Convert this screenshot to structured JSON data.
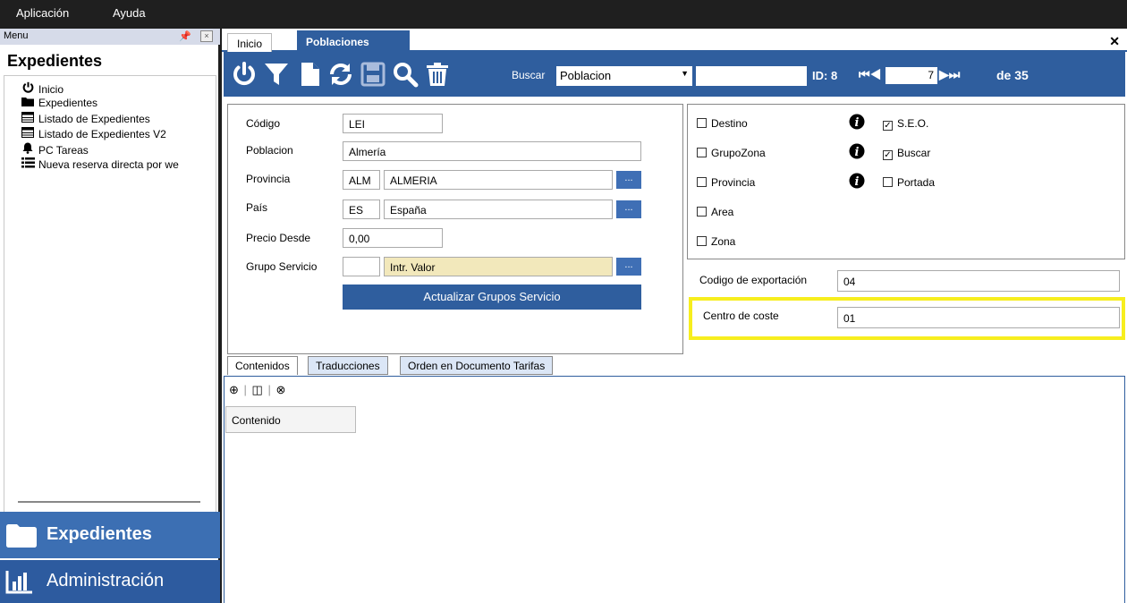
{
  "menubar": {
    "items": [
      "Aplicación",
      "Ayuda"
    ]
  },
  "leftpanel": {
    "header": "Menu",
    "title": "Expedientes",
    "tree": [
      {
        "label": "Inicio",
        "icon": "power-icon"
      },
      {
        "label": "Expedientes",
        "icon": "folder-icon"
      },
      {
        "label": "Listado de Expedientes",
        "icon": "table-icon"
      },
      {
        "label": "Listado de Expedientes V2",
        "icon": "table-icon"
      },
      {
        "label": "PC Tareas",
        "icon": "bell-icon"
      },
      {
        "label": "Nueva reserva directa por we",
        "icon": "list-icon"
      }
    ],
    "nav": {
      "expedientes": "Expedientes",
      "administracion": "Administración"
    }
  },
  "tabs": {
    "inicio": "Inicio",
    "poblaciones": "Poblaciones"
  },
  "toolbar": {
    "buscar_label": "Buscar",
    "buscar_select": "Poblacion",
    "id_label": "ID: 8",
    "page": "7",
    "total": "de 35"
  },
  "form": {
    "codigo_label": "Código",
    "codigo": "LEI",
    "poblacion_label": "Poblacion",
    "poblacion": "Almería",
    "provincia_label": "Provincia",
    "provincia_code": "ALM",
    "provincia_name": "ALMERIA",
    "pais_label": "País",
    "pais_code": "ES",
    "pais_name": "España",
    "precio_label": "Precio Desde",
    "precio": "0,00",
    "grupo_label": "Grupo Servicio",
    "grupo_code": "",
    "grupo_name": "Intr. Valor",
    "update_button": "Actualizar Grupos Servicio",
    "dots": "..."
  },
  "checks": {
    "destino": "Destino",
    "grupozona": "GrupoZona",
    "provincia": "Provincia",
    "area": "Area",
    "zona": "Zona",
    "seo": "S.E.O.",
    "buscar": "Buscar",
    "portada": "Portada"
  },
  "export": {
    "codigo_label": "Codigo de exportación",
    "codigo": "04",
    "centro_label": "Centro de coste",
    "centro": "01"
  },
  "bottom": {
    "tabs": [
      "Contenidos",
      "Traducciones",
      "Orden en Documento Tarifas"
    ],
    "column": "Contenido"
  },
  "colors": {
    "accent": "#2f5e9e",
    "highlight": "#f7ee1e",
    "nav": "#3c6fb3"
  }
}
